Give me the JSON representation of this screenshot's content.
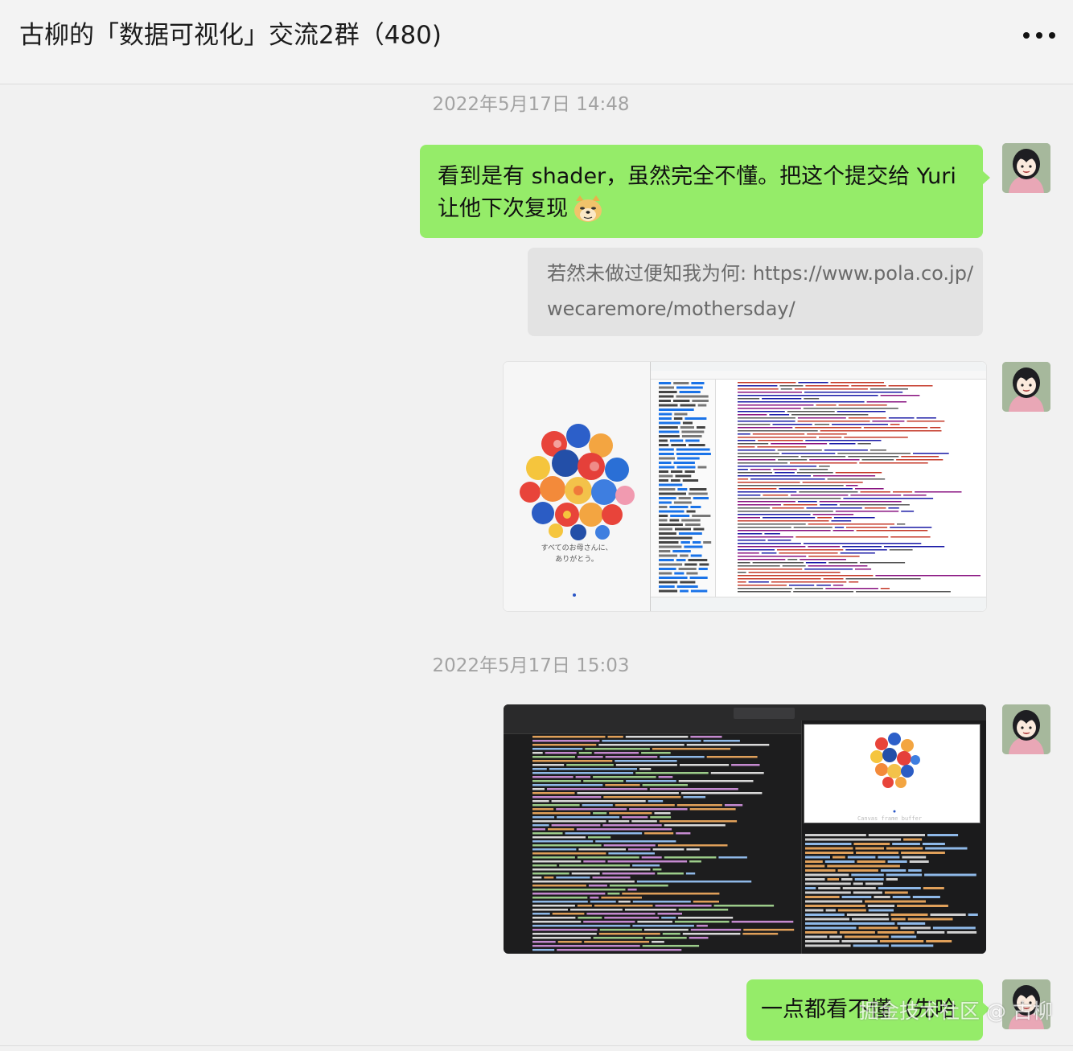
{
  "header": {
    "title": "古柳的「数据可视化」交流2群（480)"
  },
  "timestamps": [
    "2022年5月17日 14:48",
    "2022年5月17日 15:03"
  ],
  "messages": [
    {
      "type": "text",
      "side": "right",
      "bubble": "green",
      "lines": [
        "看到是有 shader，虽然完全不懂。把这个提交给 Yuri",
        "让他下次复现"
      ],
      "emoji": "doge"
    },
    {
      "type": "text",
      "side": "right",
      "bubble": "quote",
      "lines": [
        "若然未做过便知我为何: https://www.pola.co.jp/",
        "wecaremore/mothersday/"
      ]
    },
    {
      "type": "image",
      "side": "right",
      "caption": [
        "すべてのお母さんに、",
        "ありがとう。"
      ]
    },
    {
      "type": "image",
      "side": "right",
      "panel_text": "Canvas frame buffer"
    },
    {
      "type": "text",
      "side": "right",
      "bubble": "green",
      "lines": [
        "一点都看不懂（先哈"
      ]
    }
  ],
  "watermark": "掘金技术社区 @ 古柳",
  "colors": {
    "green_bubble": "#95ec69",
    "quote_bubble": "#e3e3e3",
    "background": "#f1f1f1"
  }
}
